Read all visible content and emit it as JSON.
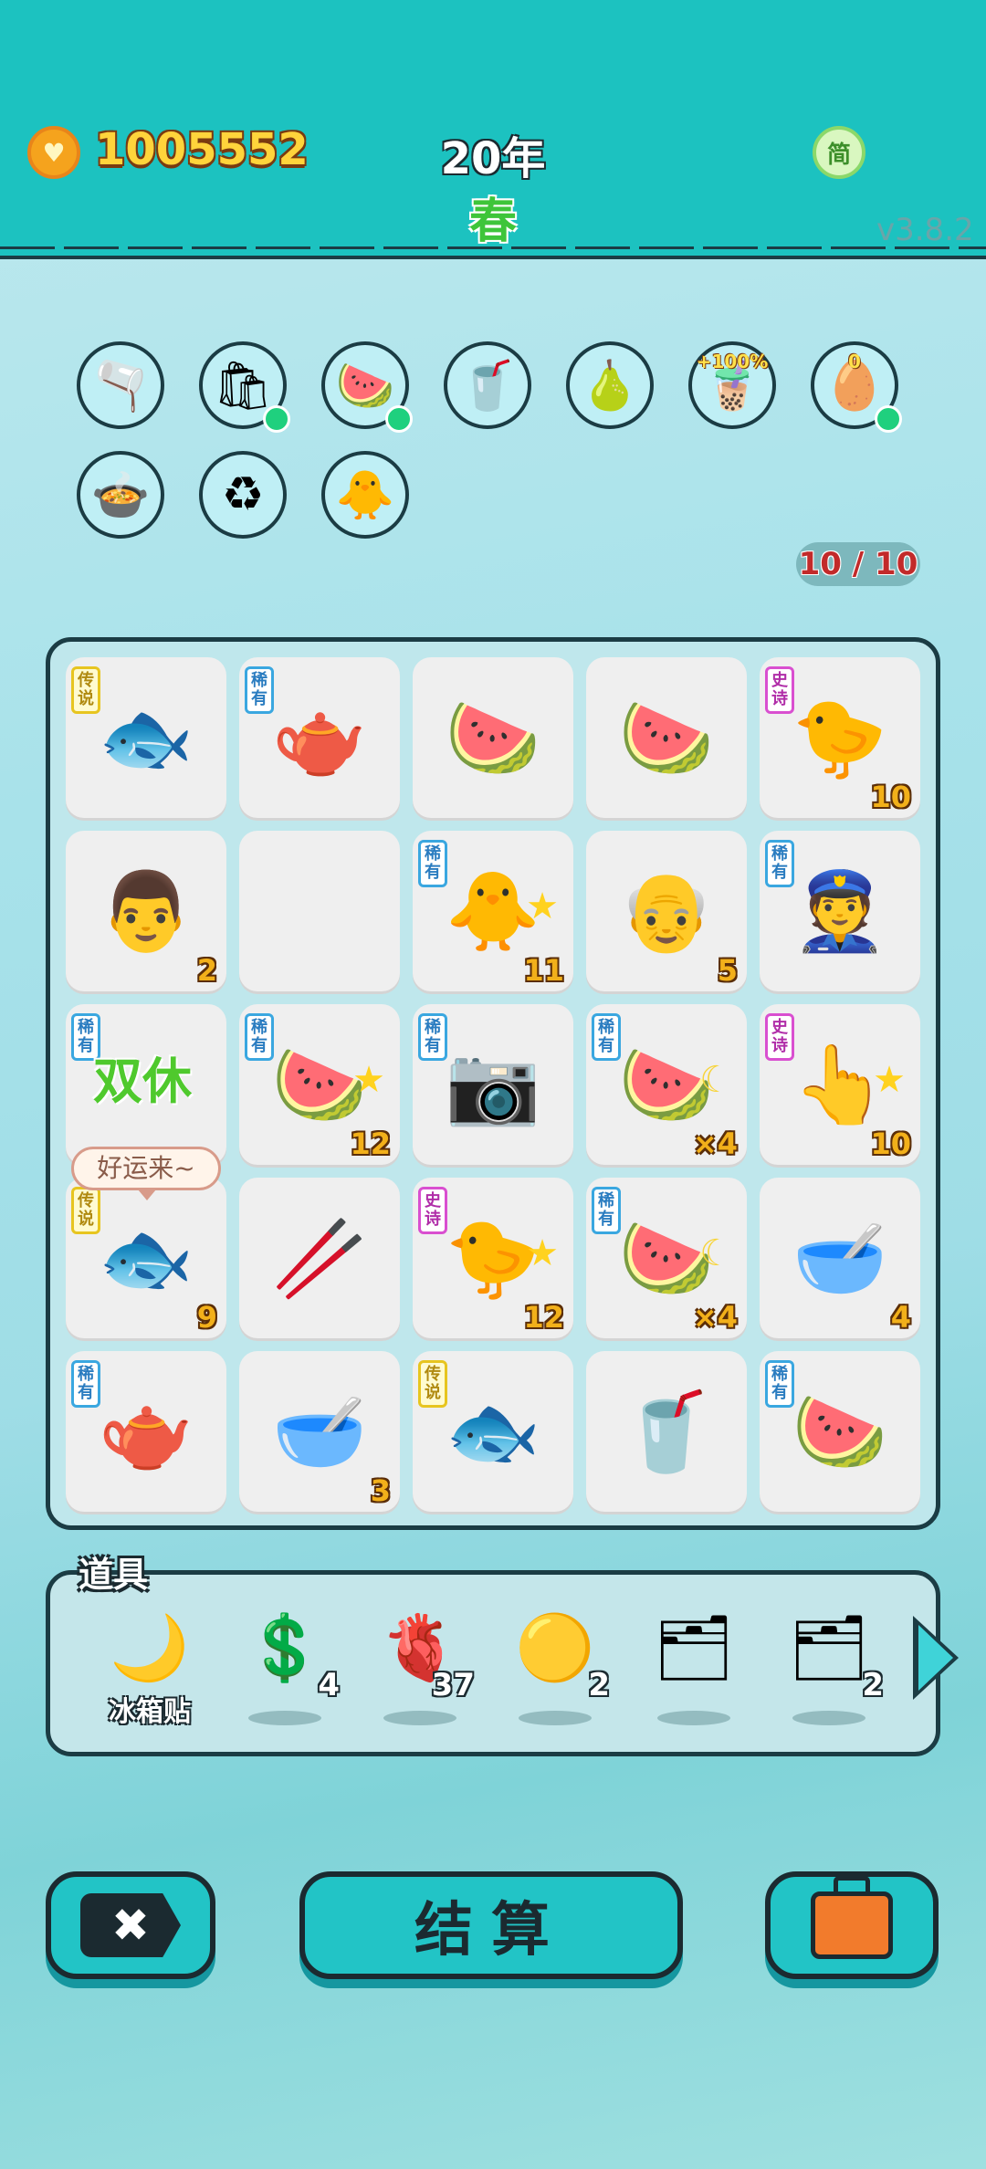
{
  "header": {
    "coins": "1005552",
    "year": "20年",
    "season": "春",
    "simplified_label": "简",
    "version": "v3.8.2"
  },
  "shop": {
    "row1": [
      {
        "name": "milk-jug",
        "icon": "🫗",
        "dot": false
      },
      {
        "name": "seed-bag",
        "icon": "🛍",
        "dot": true
      },
      {
        "name": "fruit-basket",
        "icon": "🍉",
        "dot": true
      },
      {
        "name": "bubble-tea-cup",
        "icon": "🥤",
        "dot": false
      },
      {
        "name": "pear-grapefruit",
        "icon": "🍐",
        "dot": false
      },
      {
        "name": "tea-boost",
        "icon": "🧋",
        "badge": "+100%",
        "dot": false
      },
      {
        "name": "egg-tray",
        "icon": "🥚",
        "badge": "0",
        "dot": true
      }
    ],
    "row2": [
      {
        "name": "duck-pot",
        "icon": "🍲"
      },
      {
        "name": "recycle",
        "icon": "♻"
      },
      {
        "name": "chick-egg",
        "icon": "🐥"
      }
    ]
  },
  "capacity": "10 / 10",
  "tags": {
    "rare": "稀有",
    "epic": "史诗",
    "legend": "传说"
  },
  "board": [
    [
      {
        "item": "koi-fish",
        "icon": "🐟",
        "tag": "legend",
        "count": ""
      },
      {
        "item": "teapot",
        "icon": "🫖",
        "tag": "rare",
        "count": ""
      },
      {
        "item": "watermelon-slice",
        "icon": "🍉",
        "tag": "",
        "count": ""
      },
      {
        "item": "watermelon-slice",
        "icon": "🍉",
        "tag": "",
        "count": ""
      },
      {
        "item": "yellow-chick-face",
        "icon": "🐤",
        "tag": "epic",
        "count": "10"
      }
    ],
    [
      {
        "item": "man-face",
        "icon": "👨",
        "tag": "",
        "count": "2"
      },
      {
        "item": "empty",
        "icon": "",
        "tag": "",
        "count": ""
      },
      {
        "item": "chick",
        "icon": "🐥",
        "tag": "rare",
        "count": "11",
        "star": true
      },
      {
        "item": "grandpa-face",
        "icon": "👴",
        "tag": "",
        "count": "5"
      },
      {
        "item": "police-face",
        "icon": "👮",
        "tag": "rare",
        "count": ""
      }
    ],
    [
      {
        "item": "weekend-sign",
        "icon": "",
        "tag": "rare",
        "count": "",
        "text": "双休"
      },
      {
        "item": "watermelon-slice",
        "icon": "🍉",
        "tag": "rare",
        "count": "12",
        "star": true
      },
      {
        "item": "camera",
        "icon": "📷",
        "tag": "rare",
        "count": ""
      },
      {
        "item": "watermelon-slice",
        "icon": "🍉",
        "tag": "rare",
        "count": "×4",
        "moon": true
      },
      {
        "item": "pointing-hand",
        "icon": "👆",
        "tag": "epic",
        "count": "10",
        "star": true
      }
    ],
    [
      {
        "item": "koi-fish",
        "icon": "🐟",
        "tag": "legend",
        "count": "9"
      },
      {
        "item": "straw",
        "icon": "🥢",
        "tag": "",
        "count": ""
      },
      {
        "item": "yellow-chick-face",
        "icon": "🐤",
        "tag": "epic",
        "count": "12",
        "star": true
      },
      {
        "item": "watermelon-slice",
        "icon": "🍉",
        "tag": "rare",
        "count": "×4",
        "moon": true
      },
      {
        "item": "soup-bowl",
        "icon": "🥣",
        "tag": "",
        "count": "4"
      }
    ],
    [
      {
        "item": "teapot",
        "icon": "🫖",
        "tag": "rare",
        "count": ""
      },
      {
        "item": "soup-bowl",
        "icon": "🥣",
        "tag": "",
        "count": "3"
      },
      {
        "item": "koi-fish",
        "icon": "🐟",
        "tag": "legend",
        "count": ""
      },
      {
        "item": "bubble-tea-cup",
        "icon": "🥤",
        "tag": "",
        "count": ""
      },
      {
        "item": "watermelon-slice",
        "icon": "🍉",
        "tag": "rare",
        "count": ""
      }
    ]
  ],
  "bubble": "好运来~",
  "props": {
    "title": "道具",
    "items": [
      {
        "name": "fridge-magnet",
        "icon": "🌙",
        "label": "冰箱贴",
        "count": ""
      },
      {
        "name": "dollar-coin",
        "icon": "💲",
        "label": "",
        "count": "4"
      },
      {
        "name": "liver",
        "icon": "🫀",
        "label": "",
        "count": "37"
      },
      {
        "name": "gold-ball",
        "icon": "🟡",
        "label": "",
        "count": "2"
      },
      {
        "name": "rare-tag-pack",
        "icon": "🗂",
        "label": "",
        "count": ""
      },
      {
        "name": "epic-tag-pack",
        "icon": "🗂",
        "label": "",
        "count": "2"
      }
    ]
  },
  "buttons": {
    "discard": "✖",
    "settle": "结算",
    "bag": ""
  }
}
